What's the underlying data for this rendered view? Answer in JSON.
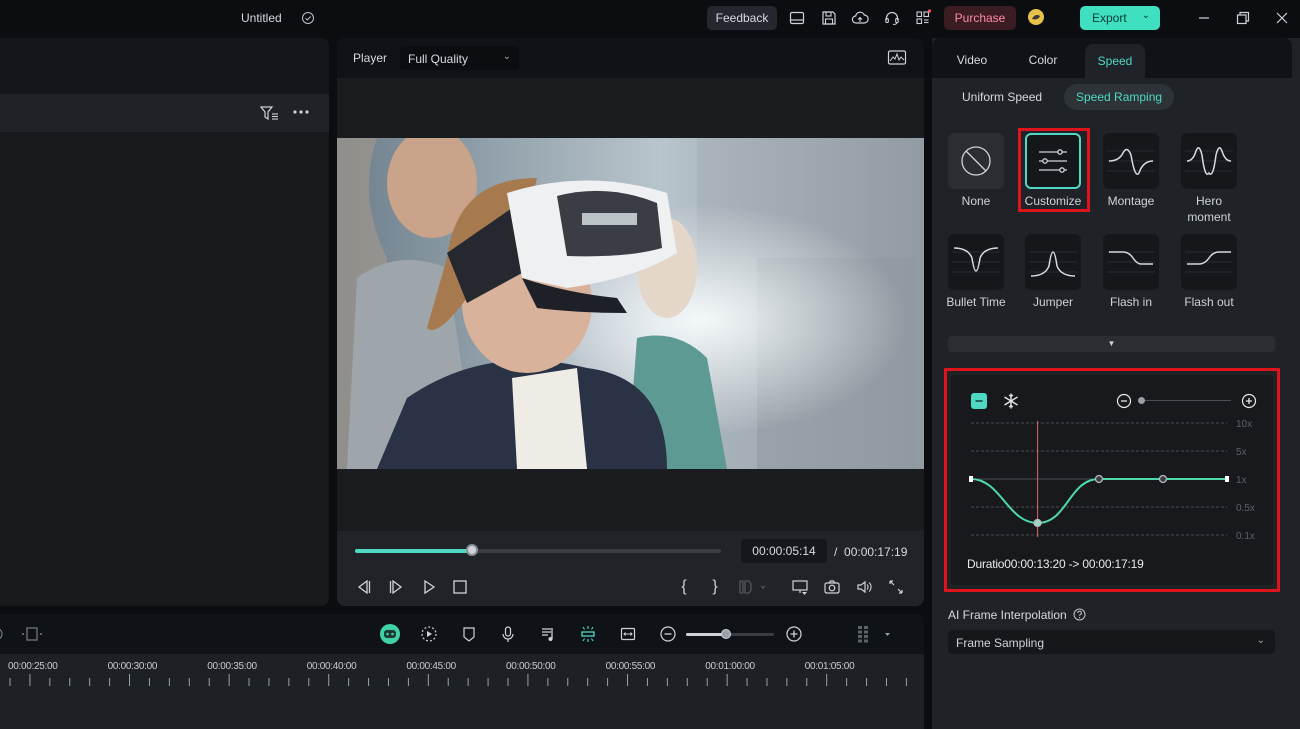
{
  "titlebar": {
    "project_title": "Untitled",
    "feedback_label": "Feedback",
    "purchase_label": "Purchase",
    "export_label": "Export",
    "colors": {
      "accent": "#3fe0c0",
      "purchase_text": "#ff8aa6",
      "highlight": "#e0141d"
    }
  },
  "player": {
    "label": "Player",
    "quality": "Full Quality",
    "current_time": "00:00:05:14",
    "separator": "/",
    "total_time": "00:00:17:19",
    "progress_fraction": 0.32,
    "bracket_in": "{",
    "bracket_out": "}"
  },
  "timeline": {
    "zoom_fraction": 0.45,
    "ruler_labels": [
      "00:00:25:00",
      "00:00:30:00",
      "00:00:35:00",
      "00:00:40:00",
      "00:00:45:00",
      "00:00:50:00",
      "00:00:55:00",
      "00:01:00:00",
      "00:01:05:00"
    ]
  },
  "right_panel": {
    "tabs": [
      {
        "label": "Video"
      },
      {
        "label": "Color"
      },
      {
        "label": "Speed",
        "active": true
      }
    ],
    "modes": [
      {
        "label": "Uniform Speed"
      },
      {
        "label": "Speed Ramping",
        "active": true
      }
    ],
    "presets": [
      {
        "label": "None",
        "icon": "none-icon"
      },
      {
        "label": "Customize",
        "icon": "sliders-icon",
        "selected": true
      },
      {
        "label": "Montage",
        "icon": "montage-curve-icon"
      },
      {
        "label": "Hero moment",
        "icon": "hero-curve-icon"
      },
      {
        "label": "Bullet Time",
        "icon": "bullet-curve-icon"
      },
      {
        "label": "Jumper",
        "icon": "jumper-curve-icon"
      },
      {
        "label": "Flash in",
        "icon": "flash-in-curve-icon"
      },
      {
        "label": "Flash out",
        "icon": "flash-out-curve-icon"
      }
    ],
    "curve_editor": {
      "speed_levels": [
        "10x",
        "5x",
        "1x",
        "0.5x",
        "0.1x"
      ],
      "duration_text": "Duratio00:00:13:20 -> 00:00:17:19",
      "zoom_fraction": 0.0,
      "playhead_fraction": 0.26,
      "keypoints": [
        {
          "t": 0.0,
          "speed": "1x"
        },
        {
          "t": 0.26,
          "speed": "0.1x-0.5x"
        },
        {
          "t": 0.5,
          "speed": "1x"
        },
        {
          "t": 0.75,
          "speed": "1x"
        },
        {
          "t": 1.0,
          "speed": "1x"
        }
      ]
    },
    "ai_frame_interpolation": {
      "label": "AI Frame Interpolation",
      "value": "Frame Sampling"
    }
  }
}
